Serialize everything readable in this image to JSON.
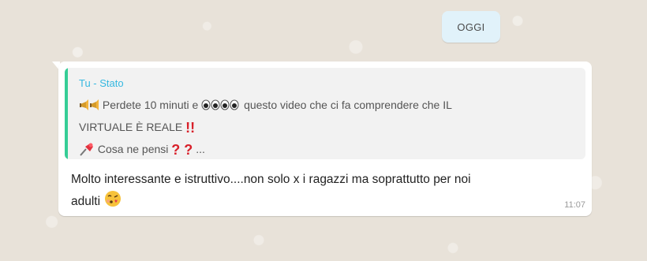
{
  "date_pill": "OGGI",
  "message": {
    "reply_quote": {
      "author": "Tu - Stato",
      "line1_text": "Perdete 10 minuti e",
      "line1_tail": "questo video che ci fa comprendere che IL",
      "line2_text": "VIRTUALE È REALE",
      "line2_marks": "!!",
      "line3_text": "Cosa ne pensi",
      "line3_marks": "? ?",
      "line3_tail": "..."
    },
    "body_line1": "Molto interessante e istruttivo....non solo x i ragazzi ma soprattutto per noi",
    "body_line2": "adulti",
    "time": "11:07"
  },
  "colors": {
    "quote_bar": "#35cd96",
    "author": "#35b8e0",
    "date_pill_bg": "#e1f2fa",
    "wallpaper": "#e8e2d9"
  },
  "icons": {
    "megaphone": "megaphone-icon",
    "eyes": "eyes-icon",
    "pushpin": "pushpin-icon",
    "kiss_face": "face-blowing-kiss-icon"
  }
}
